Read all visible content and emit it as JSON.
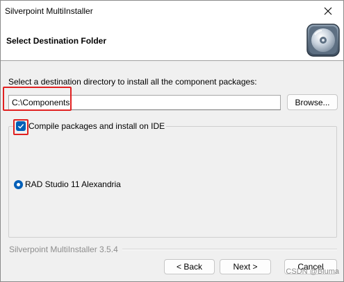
{
  "window": {
    "title": "Silverpoint MultiInstaller",
    "close_icon": "close-icon"
  },
  "header": {
    "heading": "Select Destination Folder",
    "logo_icon": "disc-logo-icon"
  },
  "destination": {
    "prompt": "Select a destination directory to install all the component packages:",
    "value": "C:\\Components",
    "browse_label": "Browse..."
  },
  "options": {
    "compile_label": "Compile packages and install on IDE",
    "compile_checked": true,
    "ide_options": [
      {
        "label": "RAD Studio 11 Alexandria",
        "selected": true
      }
    ]
  },
  "footer": {
    "version": "Silverpoint MultiInstaller 3.5.4",
    "back_label": "< Back",
    "next_label": "Next >",
    "cancel_label": "Cancel"
  },
  "watermark": "CSDN @Bluma",
  "colors": {
    "accent": "#005fb8",
    "highlight": "#e02020"
  }
}
